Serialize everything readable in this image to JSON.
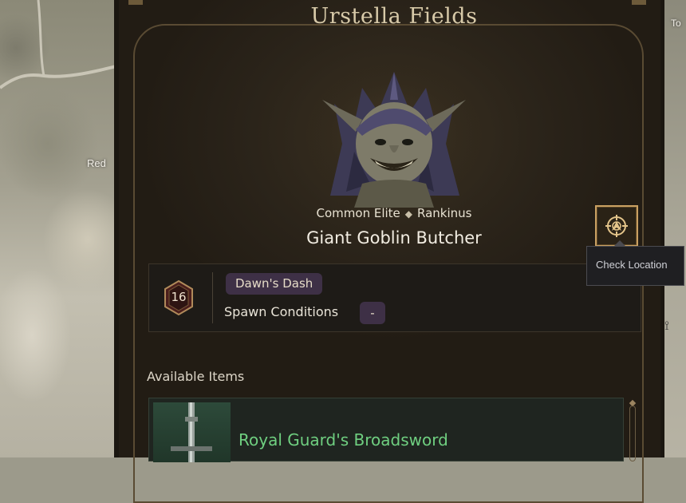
{
  "map": {
    "labels": [
      "Red",
      "To"
    ]
  },
  "panel": {
    "region_title": "Urstella Fields",
    "monster": {
      "grade": "Common Elite",
      "type": "Rankinus",
      "name": "Giant Goblin Butcher"
    },
    "check_location": {
      "icon": "compass-target-icon",
      "tooltip": "Check Location"
    },
    "info": {
      "level": "16",
      "event_tag": "Dawn's Dash",
      "spawn_label": "Spawn Conditions",
      "spawn_value": "-"
    },
    "available_items": {
      "label": "Available Items",
      "items": [
        {
          "name": "Royal Guard's Broadsword",
          "color": "#6fcf80"
        }
      ]
    }
  },
  "colors": {
    "accent_gold": "#c9a062",
    "item_green": "#6fcf80",
    "tag_purple": "#3e3046"
  }
}
